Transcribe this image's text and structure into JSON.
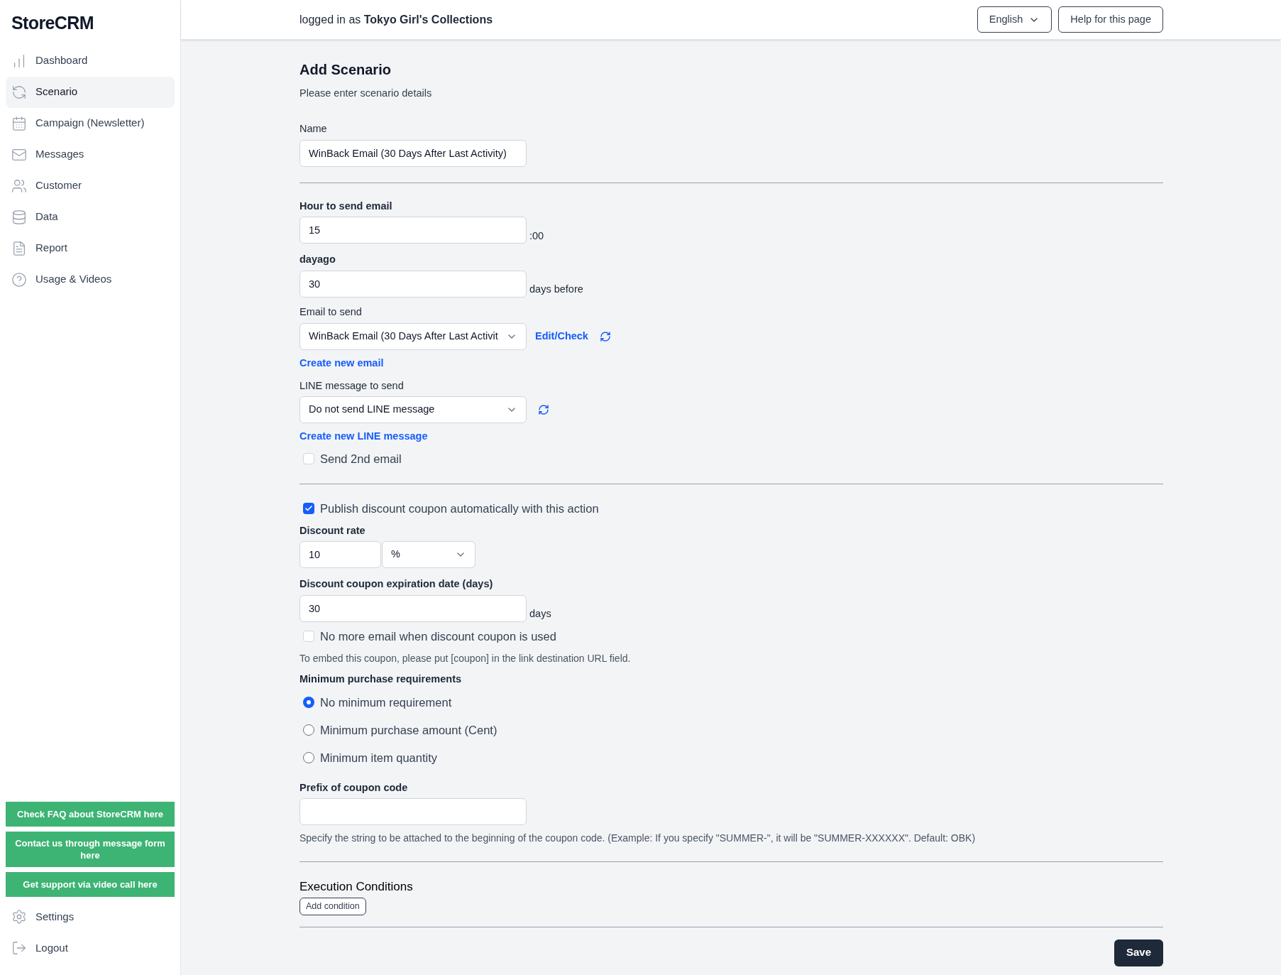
{
  "brand": "StoreCRM",
  "sidebar": {
    "items": [
      {
        "label": "Dashboard",
        "selected": false
      },
      {
        "label": "Scenario",
        "selected": true
      },
      {
        "label": "Campaign (Newsletter)",
        "selected": false
      },
      {
        "label": "Messages",
        "selected": false
      },
      {
        "label": "Customer",
        "selected": false
      },
      {
        "label": "Data",
        "selected": false
      },
      {
        "label": "Report",
        "selected": false
      },
      {
        "label": "Usage & Videos",
        "selected": false
      }
    ],
    "help_buttons": [
      "Check FAQ about StoreCRM here",
      "Contact us through message form here",
      "Get support via video call here"
    ],
    "bottom_items": [
      {
        "label": "Settings",
        "selected": false
      },
      {
        "label": "Logout",
        "selected": false
      }
    ]
  },
  "header": {
    "account_line": "logged in as **Tokyo Girl's Collections**",
    "language": "English",
    "help_button": "Help for this page"
  },
  "form": {
    "title": "Add Scenario",
    "subtitle": "Please enter scenario details",
    "sections": [
      [
        {
          "kind": "input",
          "label": "Name",
          "strong": false,
          "value": "WinBack Email (30 Days After Last Activity)"
        }
      ],
      [
        {
          "kind": "input",
          "label": "Hour to send email",
          "strong": true,
          "value": "15",
          "suffix": ":00"
        },
        {
          "kind": "input",
          "label": "dayago",
          "strong": true,
          "value": "30",
          "suffix": "days before"
        },
        {
          "kind": "select",
          "label": "Email to send",
          "strong": false,
          "value": "WinBack Email (30 Days After Last Activit",
          "link": "Edit/Check",
          "refresh": true
        },
        {
          "kind": "link",
          "text": "Create new email"
        },
        {
          "kind": "select",
          "label": "LINE message to send",
          "strong": false,
          "value": "Do not send LINE message",
          "refresh": true
        },
        {
          "kind": "link",
          "text": "Create new LINE message"
        },
        {
          "kind": "checkbox",
          "label": "Send 2nd email",
          "checked": false
        }
      ],
      [
        {
          "kind": "checkbox",
          "label": "Publish discount coupon automatically with this action",
          "checked": true
        },
        {
          "kind": "rate",
          "label": "Discount rate",
          "strong": true,
          "value": "10",
          "unit": "%"
        },
        {
          "kind": "input",
          "label": "Discount coupon expiration date (days)",
          "strong": true,
          "value": "30",
          "suffix": "days"
        },
        {
          "kind": "checkbox",
          "label": "No more email when discount coupon is used",
          "checked": false
        },
        {
          "kind": "note",
          "text": "To embed this coupon, please put [coupon] in the link destination URL field."
        },
        {
          "kind": "radios",
          "label": "Minimum purchase requirements",
          "strong": true,
          "options": [
            {
              "label": "No minimum requirement",
              "selected": true
            },
            {
              "label": "Minimum purchase amount (Cent)",
              "selected": false
            },
            {
              "label": "Minimum item quantity",
              "selected": false
            }
          ]
        },
        {
          "kind": "input",
          "label": "Prefix of coupon code",
          "strong": true
        },
        {
          "kind": "note",
          "text": "Specify the string to be attached to the beginning of the coupon code. (Example: If you specify \"SUMMER-\", it will be \"SUMMER-XXXXXX\". Default: OBK)"
        }
      ],
      [
        {
          "kind": "heading",
          "text": "Execution Conditions",
          "button": "Add condition"
        }
      ]
    ],
    "save_button": "Save"
  }
}
